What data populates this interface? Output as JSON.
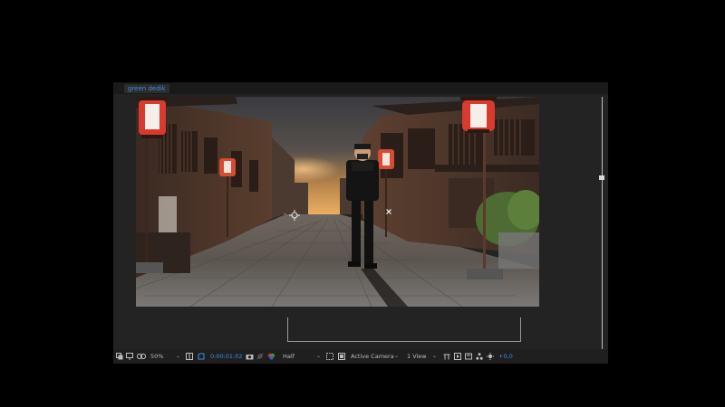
{
  "composition_tab": {
    "label": "green dedik"
  },
  "toolbar": {
    "magnification": "50%",
    "timecode": "0:00:01:02",
    "resolution": "Half",
    "camera": "Active Camera",
    "views": "1 View",
    "exposure": "+0,0"
  },
  "colors": {
    "accent": "#3b8ede",
    "panel": "#232323",
    "toolbar": "#1f1f1f"
  }
}
